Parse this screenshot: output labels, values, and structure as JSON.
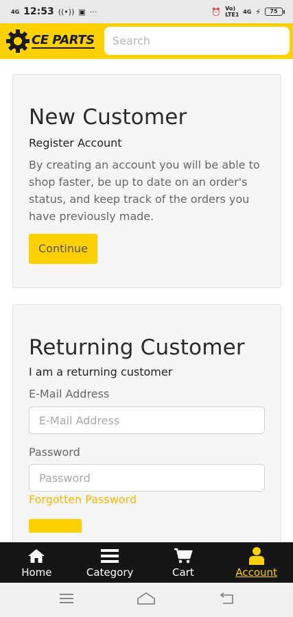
{
  "status_bar": {
    "signal_left": "4G",
    "time": "12:53",
    "more": "···",
    "net_label": "Vo) LTE1",
    "net_type": "4G",
    "battery": "75"
  },
  "header": {
    "logo_text": "CE PARTS",
    "search_placeholder": "Search"
  },
  "new_customer": {
    "title": "New Customer",
    "subtitle": "Register Account",
    "description": "By creating an account you will be able to shop faster, be up to date on an order's status, and keep track of the orders you have previously made.",
    "button_label": "Continue"
  },
  "returning_customer": {
    "title": "Returning Customer",
    "subtitle": "I am a returning customer",
    "email_label": "E-Mail Address",
    "email_placeholder": "E-Mail Address",
    "password_label": "Password",
    "password_placeholder": "Password",
    "forgot_link": "Forgotten Password"
  },
  "bottom_nav": {
    "items": [
      {
        "label": "Home",
        "icon": "home-icon",
        "active": false
      },
      {
        "label": "Category",
        "icon": "menu-icon",
        "active": false
      },
      {
        "label": "Cart",
        "icon": "cart-icon",
        "active": false
      },
      {
        "label": "Account",
        "icon": "user-icon",
        "active": true
      }
    ]
  },
  "colors": {
    "brand_yellow": "#fdd000",
    "link_yellow": "#f2b705",
    "nav_dark": "#161616"
  }
}
